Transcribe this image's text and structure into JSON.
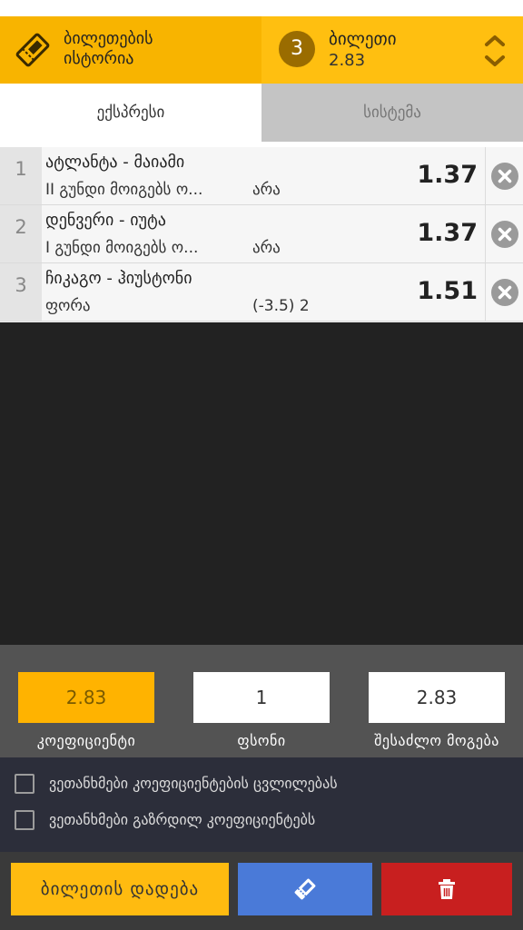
{
  "header": {
    "history_label_line1": "ბილეთების",
    "history_label_line2": "ისტორია",
    "ticket_count": "3",
    "ticket_title": "ბილეთი",
    "ticket_total_odds": "2.83"
  },
  "tabs": [
    {
      "label": "ექსპრესი",
      "active": true
    },
    {
      "label": "სისტემა",
      "active": false
    }
  ],
  "bets": [
    {
      "index": "1",
      "teams": "ატლანტა - მაიამი",
      "market": "II გუნდი მოიგებს ო...",
      "pick": "არა",
      "odds": "1.37"
    },
    {
      "index": "2",
      "teams": "დენვერი - იუტა",
      "market": "I გუნდი მოიგებს ო...",
      "pick": "არა",
      "odds": "1.37"
    },
    {
      "index": "3",
      "teams": "ჩიკაგო - ჰიუსტონი",
      "market": "ფორა",
      "pick": "(-3.5) 2",
      "odds": "1.51"
    }
  ],
  "controls": {
    "coefficient_value": "2.83",
    "stake_value": "1",
    "possible_win_value": "2.83",
    "coefficient_label": "კოეფიციენტი",
    "stake_label": "ფსონი",
    "possible_win_label": "შესაძლო მოგება"
  },
  "agreements": [
    {
      "label": "ვეთანხმები კოეფიციენტების ცვლილებას",
      "checked": false
    },
    {
      "label": "ვეთანხმები გაზრდილ კოეფიციენტებს",
      "checked": false
    }
  ],
  "actions": {
    "place_bet_label": "ბილეთის დადება"
  },
  "icons": {
    "history": "ticket-icon",
    "expand": "chevron-up-down-icon",
    "remove": "close-circle-icon",
    "ticket_button": "ticket-icon",
    "delete_button": "trash-icon"
  },
  "colors": {
    "accent": "#f8b400",
    "blue": "#4a7ad8",
    "red": "#c81f1f",
    "dark": "#222222"
  }
}
